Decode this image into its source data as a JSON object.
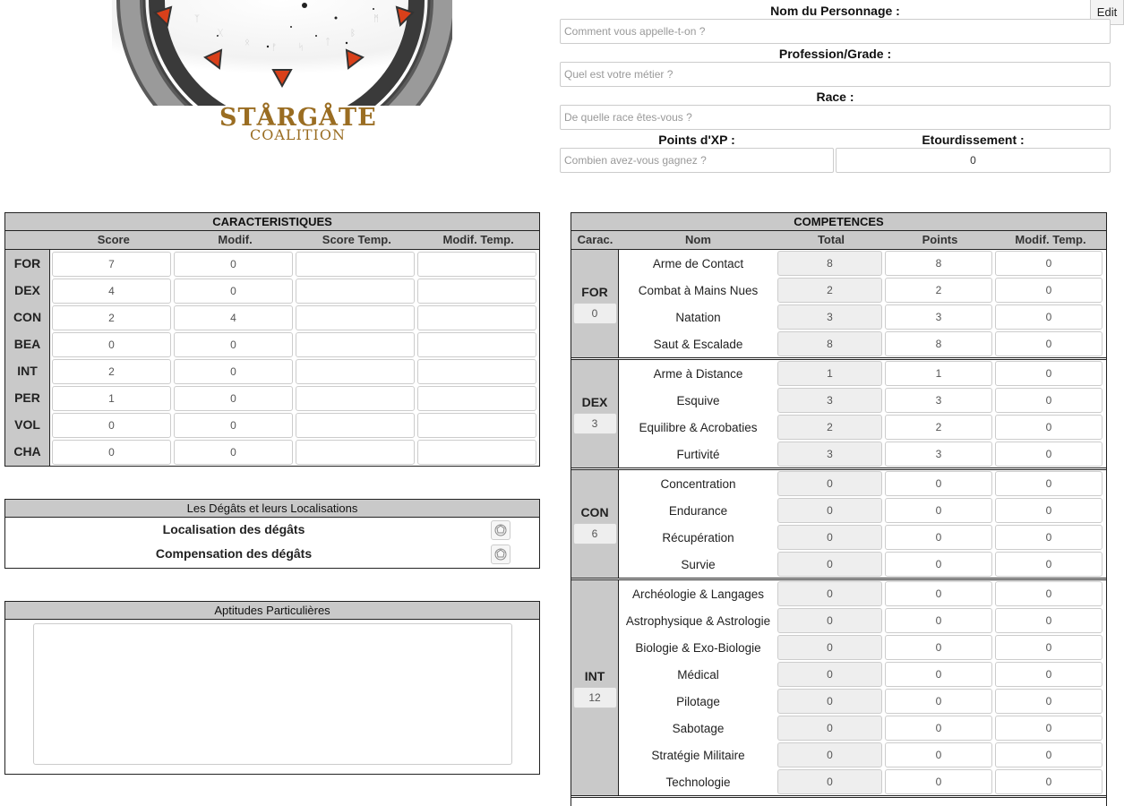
{
  "edit_label": "Edit",
  "logo": {
    "line1": "STÅRGÅTE",
    "line2": "COALITION"
  },
  "identity": {
    "name_label": "Nom du Personnage :",
    "name_placeholder": "Comment vous appelle-t-on ?",
    "profession_label": "Profession/Grade :",
    "profession_placeholder": "Quel est votre métier ?",
    "race_label": "Race :",
    "race_placeholder": "De quelle race êtes-vous ?",
    "xp_label": "Points d'XP :",
    "xp_placeholder": "Combien avez-vous gagnez ?",
    "stun_label": "Etourdissement :",
    "stun_value": "0"
  },
  "characteristics": {
    "title": "CARACTERISTIQUES",
    "headers": [
      "Score",
      "Modif.",
      "Score Temp.",
      "Modif. Temp."
    ],
    "rows": [
      {
        "abbr": "FOR",
        "score": "7",
        "modif": "0",
        "score_temp": "",
        "modif_temp": ""
      },
      {
        "abbr": "DEX",
        "score": "4",
        "modif": "0",
        "score_temp": "",
        "modif_temp": ""
      },
      {
        "abbr": "CON",
        "score": "2",
        "modif": "4",
        "score_temp": "",
        "modif_temp": ""
      },
      {
        "abbr": "BEA",
        "score": "0",
        "modif": "0",
        "score_temp": "",
        "modif_temp": ""
      },
      {
        "abbr": "INT",
        "score": "2",
        "modif": "0",
        "score_temp": "",
        "modif_temp": ""
      },
      {
        "abbr": "PER",
        "score": "1",
        "modif": "0",
        "score_temp": "",
        "modif_temp": ""
      },
      {
        "abbr": "VOL",
        "score": "0",
        "modif": "0",
        "score_temp": "",
        "modif_temp": ""
      },
      {
        "abbr": "CHA",
        "score": "0",
        "modif": "0",
        "score_temp": "",
        "modif_temp": ""
      }
    ]
  },
  "damages": {
    "title": "Les Dégâts et leurs Localisations",
    "localisation_label": "Localisation des dégâts",
    "compensation_label": "Compensation des dégâts"
  },
  "aptitudes": {
    "title": "Aptitudes Particulières",
    "value": ""
  },
  "competences": {
    "title": "COMPETENCES",
    "headers": [
      "Carac.",
      "Nom",
      "Total",
      "Points",
      "Modif. Temp."
    ],
    "groups": [
      {
        "attr": "FOR",
        "value": "0",
        "skills": [
          {
            "name": "Arme de Contact",
            "total": "8",
            "points": "8",
            "mod": "0"
          },
          {
            "name": "Combat à Mains Nues",
            "total": "2",
            "points": "2",
            "mod": "0"
          },
          {
            "name": "Natation",
            "total": "3",
            "points": "3",
            "mod": "0"
          },
          {
            "name": "Saut & Escalade",
            "total": "8",
            "points": "8",
            "mod": "0"
          }
        ]
      },
      {
        "attr": "DEX",
        "value": "3",
        "skills": [
          {
            "name": "Arme à Distance",
            "total": "1",
            "points": "1",
            "mod": "0"
          },
          {
            "name": "Esquive",
            "total": "3",
            "points": "3",
            "mod": "0"
          },
          {
            "name": "Equilibre & Acrobaties",
            "total": "2",
            "points": "2",
            "mod": "0"
          },
          {
            "name": "Furtivité",
            "total": "3",
            "points": "3",
            "mod": "0"
          }
        ]
      },
      {
        "attr": "CON",
        "value": "6",
        "skills": [
          {
            "name": "Concentration",
            "total": "0",
            "points": "0",
            "mod": "0"
          },
          {
            "name": "Endurance",
            "total": "0",
            "points": "0",
            "mod": "0"
          },
          {
            "name": "Récupération",
            "total": "0",
            "points": "0",
            "mod": "0"
          },
          {
            "name": "Survie",
            "total": "0",
            "points": "0",
            "mod": "0"
          }
        ]
      },
      {
        "attr": "INT",
        "value": "12",
        "skills": [
          {
            "name": "Archéologie & Langages",
            "total": "0",
            "points": "0",
            "mod": "0"
          },
          {
            "name": "Astrophysique & Astrologie",
            "total": "0",
            "points": "0",
            "mod": "0"
          },
          {
            "name": "Biologie & Exo-Biologie",
            "total": "0",
            "points": "0",
            "mod": "0"
          },
          {
            "name": "Médical",
            "total": "0",
            "points": "0",
            "mod": "0"
          },
          {
            "name": "Pilotage",
            "total": "0",
            "points": "0",
            "mod": "0"
          },
          {
            "name": "Sabotage",
            "total": "0",
            "points": "0",
            "mod": "0"
          },
          {
            "name": "Stratégie Militaire",
            "total": "0",
            "points": "0",
            "mod": "0"
          },
          {
            "name": "Technologie",
            "total": "0",
            "points": "0",
            "mod": "0"
          }
        ]
      }
    ]
  },
  "colors": {
    "header_gray": "#c9c9c9",
    "border": "#222222",
    "logo_gold": "#9a6d22",
    "chevron_red": "#d9401a"
  }
}
